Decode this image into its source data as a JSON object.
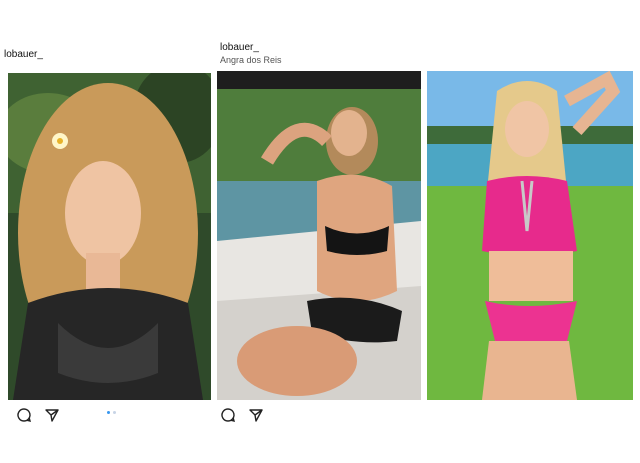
{
  "posts": [
    {
      "username": "lobauer_",
      "location": "",
      "photo_name": "photo-sheer-top-with-flower",
      "carousel_index": 1,
      "carousel_total": 2
    },
    {
      "username": "lobauer_",
      "location": "Angra dos Reis",
      "photo_name": "photo-boat-black-bikini"
    },
    {
      "username": "",
      "location": "",
      "photo_name": "photo-pink-bikini-lakeside"
    }
  ],
  "icons": [
    "comment-icon",
    "share-icon"
  ],
  "colors": {
    "accent": "#3897f0",
    "background": "#ffffff"
  }
}
